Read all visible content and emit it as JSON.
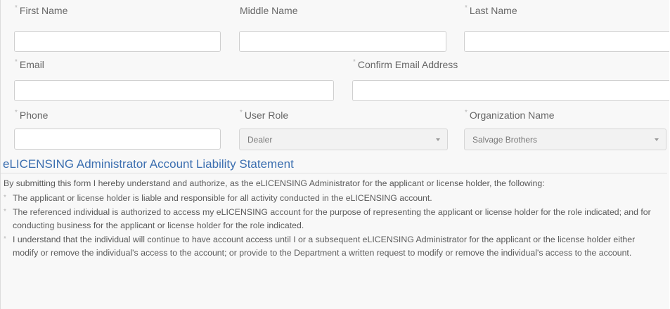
{
  "fields": {
    "first_name": {
      "label": "First Name",
      "required": "*",
      "value": ""
    },
    "middle_name": {
      "label": "Middle Name",
      "value": ""
    },
    "last_name": {
      "label": "Last Name",
      "required": "*",
      "value": ""
    },
    "email": {
      "label": "Email",
      "required": "*",
      "value": ""
    },
    "confirm_email": {
      "label": "Confirm Email Address",
      "required": "*",
      "value": ""
    },
    "phone": {
      "label": "Phone",
      "required": "*",
      "value": ""
    },
    "user_role": {
      "label": "User Role",
      "required": "*",
      "selected": "Dealer"
    },
    "organization": {
      "label": "Organization Name",
      "required": "*",
      "selected": "Salvage Brothers"
    }
  },
  "statement": {
    "title": "eLICENSING Administrator Account Liability Statement",
    "intro": "By submitting this form I hereby understand and authorize, as the eLICENSING Administrator for the applicant or license holder, the following:",
    "items": [
      "The applicant or license holder is liable and responsible for all activity conducted in the eLICENSING account.",
      "The referenced individual is authorized to access my eLICENSING account for the purpose of representing the applicant or license holder for the role indicated; and for conducting business for the applicant or license holder for the role indicated.",
      "I understand that the individual will continue to have account access until I or a subsequent eLICENSING Administrator for the applicant or the license holder either modify or remove the individual's access to the account; or provide to the Department a written request to modify or remove the individual's access to the account."
    ]
  }
}
